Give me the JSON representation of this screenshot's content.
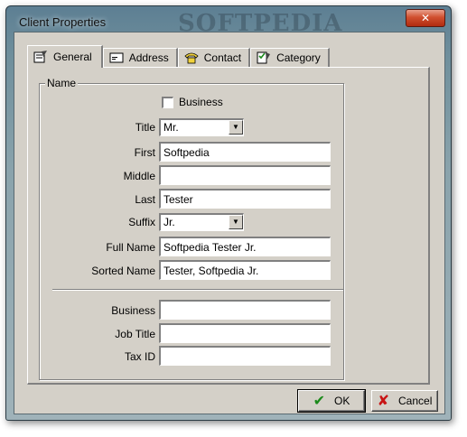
{
  "window": {
    "title": "Client Properties",
    "watermark": "SOFTPEDIA",
    "close_glyph": "✕"
  },
  "tabs": [
    {
      "label": "General",
      "icon": "form-icon",
      "active": true
    },
    {
      "label": "Address",
      "icon": "envelope-icon",
      "active": false
    },
    {
      "label": "Contact",
      "icon": "phone-icon",
      "active": false
    },
    {
      "label": "Category",
      "icon": "checklist-icon",
      "active": false
    }
  ],
  "name_group": {
    "label": "Name",
    "business_checkbox": {
      "label": "Business",
      "checked": false
    },
    "title": {
      "label": "Title",
      "value": "Mr."
    },
    "first": {
      "label": "First",
      "value": "Softpedia"
    },
    "middle": {
      "label": "Middle",
      "value": ""
    },
    "last": {
      "label": "Last",
      "value": "Tester"
    },
    "suffix": {
      "label": "Suffix",
      "value": "Jr."
    },
    "full_name": {
      "label": "Full Name",
      "value": "Softpedia Tester Jr."
    },
    "sorted_name": {
      "label": "Sorted Name",
      "value": "Tester, Softpedia Jr."
    },
    "business": {
      "label": "Business",
      "value": ""
    },
    "job_title": {
      "label": "Job Title",
      "value": ""
    },
    "tax_id": {
      "label": "Tax ID",
      "value": ""
    }
  },
  "buttons": {
    "ok": {
      "label": "OK",
      "icon": "checkmark-icon"
    },
    "cancel": {
      "label": "Cancel",
      "icon": "x-icon"
    }
  },
  "colors": {
    "ok_icon": "#1b8a1b",
    "cancel_icon": "#c81414",
    "dialog_face": "#d4d0c8"
  }
}
